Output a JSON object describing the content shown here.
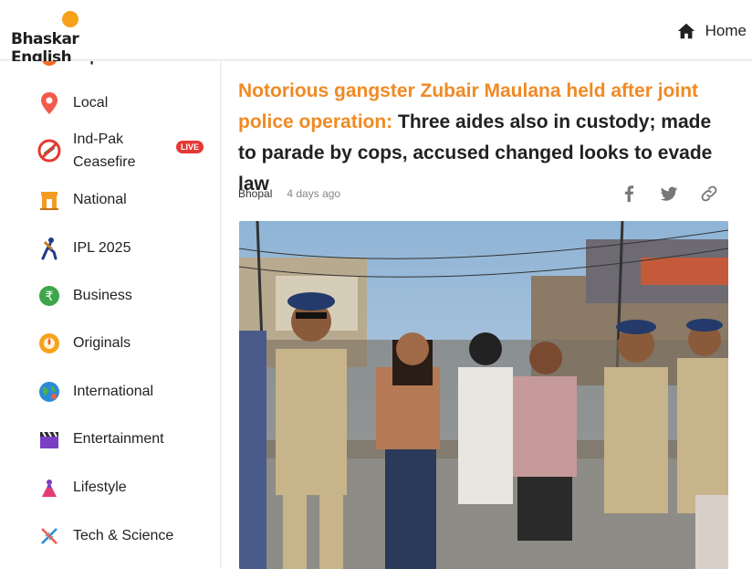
{
  "header": {
    "brand": "Bhaskar English",
    "home_label": "Home"
  },
  "sidebar": {
    "items": [
      {
        "label": "Top News",
        "icon": "top-news-icon"
      },
      {
        "label": "Local",
        "icon": "location-pin-icon"
      },
      {
        "label": "Ind-Pak",
        "label2": "Ceasefire",
        "icon": "ceasefire-icon",
        "badge": "LIVE"
      },
      {
        "label": "National",
        "icon": "india-gate-icon"
      },
      {
        "label": "IPL 2025",
        "icon": "cricket-player-icon"
      },
      {
        "label": "Business",
        "icon": "rupee-icon"
      },
      {
        "label": "Originals",
        "icon": "originals-icon"
      },
      {
        "label": "International",
        "icon": "globe-icon"
      },
      {
        "label": "Entertainment",
        "icon": "clapperboard-icon"
      },
      {
        "label": "Lifestyle",
        "icon": "lifestyle-icon"
      },
      {
        "label": "Tech & Science",
        "icon": "dna-icon"
      }
    ]
  },
  "article": {
    "headline_highlight": "Notorious gangster Zubair Maulana held after joint police operation:",
    "headline_rest": " Three aides also in custody; made to parade by cops, accused changed looks to evade law",
    "city": "Bhopal",
    "time": "4 days ago"
  },
  "colors": {
    "accent": "#f08a24",
    "live": "#e53935",
    "brand_sun": "#f7a21b"
  }
}
